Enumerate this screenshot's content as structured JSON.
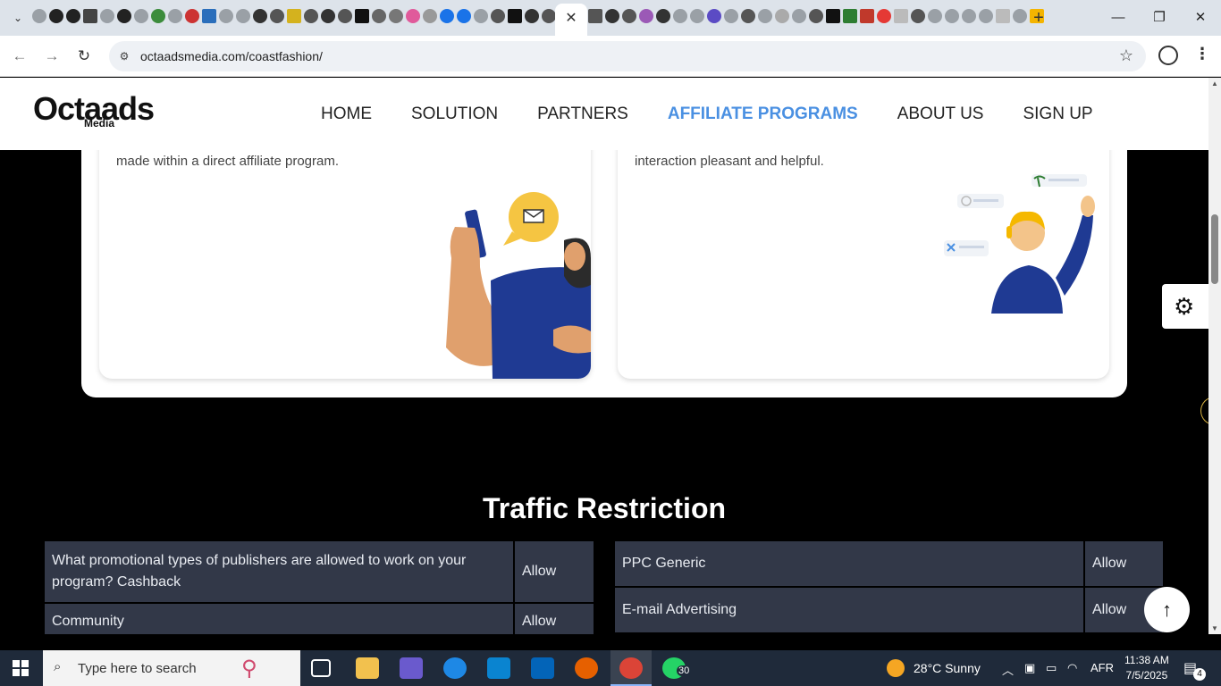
{
  "browser": {
    "tab_close_glyph": "✕",
    "new_tab_glyph": "+",
    "url": "octaadsmedia.com/coastfashion/",
    "window": {
      "minimize": "—",
      "restore": "❐",
      "close": "✕"
    }
  },
  "site": {
    "logo_main": "Octaads",
    "logo_sub": "Media",
    "nav": [
      "HOME",
      "SOLUTION",
      "PARTNERS",
      "AFFILIATE PROGRAMS",
      "ABOUT US",
      "SIGN UP"
    ],
    "nav_active": "AFFILIATE PROGRAMS"
  },
  "cards": {
    "left_text": "made within  a direct affiliate program.",
    "right_text": "interaction pleasant and helpful."
  },
  "traffic": {
    "title": "Traffic Restriction",
    "left_rows": [
      {
        "q": "What promotional types of publishers are allowed to work on your program? Cashback",
        "a": "Allow"
      },
      {
        "q": "Community",
        "a": "Allow"
      }
    ],
    "right_rows": [
      {
        "q": "PPC Generic",
        "a": "Allow"
      },
      {
        "q": "E-mail Advertising",
        "a": "Allow"
      }
    ]
  },
  "taskbar": {
    "search_placeholder": "Type here to search",
    "whatsapp_badge": "30",
    "weather": "28°C  Sunny",
    "language": "AFR",
    "time": "11:38 AM",
    "date": "7/5/2025",
    "notifications": "4"
  },
  "colors": {
    "accent": "#4a90e2",
    "table_cell": "#323848",
    "taskbar": "#1f2a3a"
  }
}
